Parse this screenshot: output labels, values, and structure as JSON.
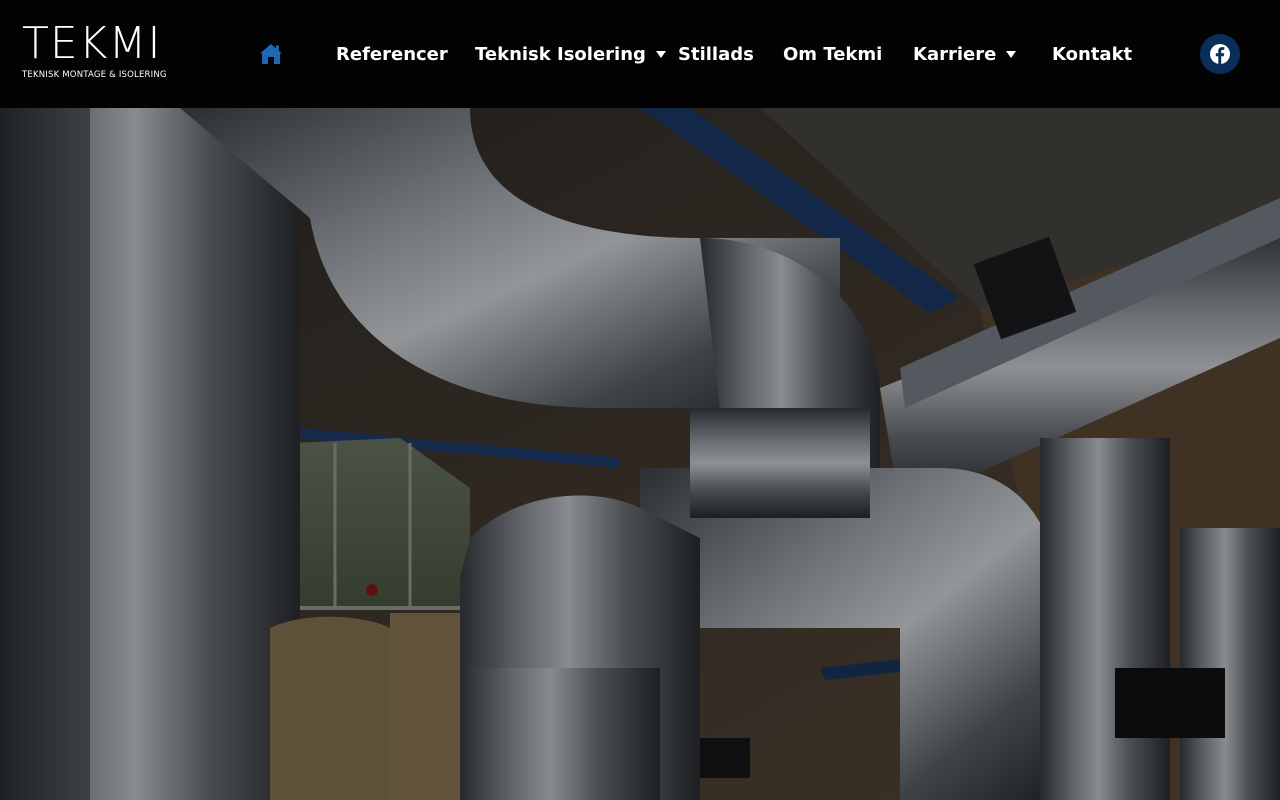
{
  "logo": {
    "name": "TEKMI",
    "tagline": "TEKNISK MONTAGE & ISOLERING"
  },
  "nav": {
    "home_icon": "home-icon",
    "items": [
      {
        "label": "Referencer",
        "has_dropdown": false
      },
      {
        "label": "Teknisk Isolering",
        "has_dropdown": true
      },
      {
        "label": "Stillads",
        "has_dropdown": false
      },
      {
        "label": "Om Tekmi",
        "has_dropdown": false
      },
      {
        "label": "Karriere",
        "has_dropdown": true
      },
      {
        "label": "Kontakt",
        "has_dropdown": false
      }
    ]
  },
  "social": {
    "icon": "facebook-icon"
  },
  "colors": {
    "header_bg": "#030303",
    "accent": "#1f66b3",
    "facebook_circle": "#0b2d5a",
    "text": "#ffffff"
  },
  "hero": {
    "image": "insulated-steel-pipes-photo"
  }
}
